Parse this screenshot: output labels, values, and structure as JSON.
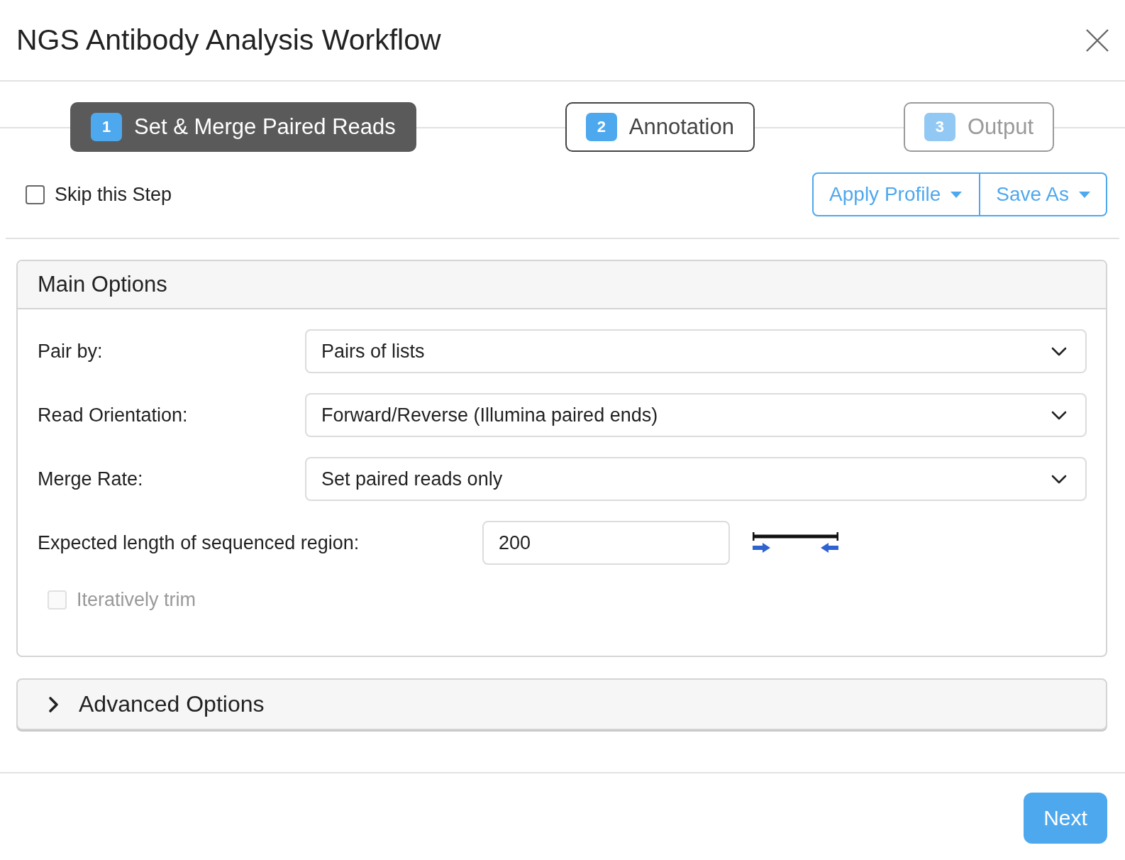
{
  "dialog": {
    "title": "NGS Antibody Analysis Workflow"
  },
  "steps": [
    {
      "number": "1",
      "label": "Set & Merge Paired Reads",
      "selected": true,
      "disabled": false
    },
    {
      "number": "2",
      "label": "Annotation",
      "selected": false,
      "disabled": false
    },
    {
      "number": "3",
      "label": "Output",
      "selected": false,
      "disabled": true
    }
  ],
  "skip_step": {
    "label": "Skip this Step",
    "checked": false
  },
  "profile_buttons": [
    {
      "label": "Apply Profile"
    },
    {
      "label": "Save As"
    }
  ],
  "main_options": {
    "title": "Main Options",
    "fields": [
      {
        "kind": "select",
        "label": "Pair by:",
        "value": "Pairs of lists"
      },
      {
        "kind": "select",
        "label": "Read Orientation:",
        "value": "Forward/Reverse (Illumina paired ends)"
      },
      {
        "kind": "select",
        "label": "Merge Rate:",
        "value": "Set paired reads only"
      },
      {
        "kind": "text",
        "label": "Expected length of sequenced region:",
        "value": "200"
      },
      {
        "kind": "checkbox",
        "label": "Iteratively trim",
        "checked": false,
        "disabled": true
      }
    ]
  },
  "advanced_options": {
    "title": "Advanced Options",
    "expanded": false
  },
  "footer": {
    "next_button": "Next"
  }
}
